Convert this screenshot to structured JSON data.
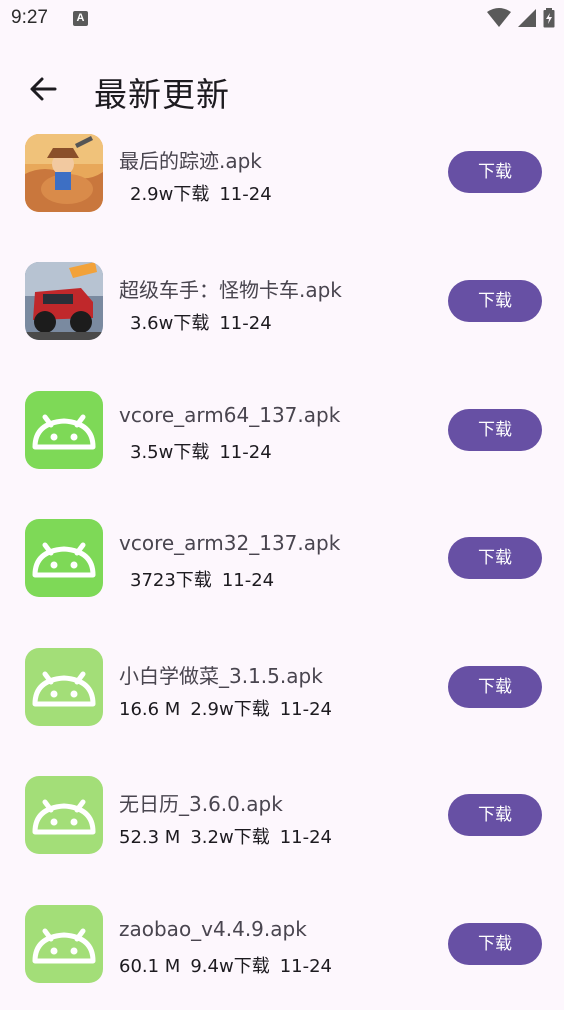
{
  "status_bar": {
    "time": "9:27",
    "notification_icon_letter": "A"
  },
  "app_bar": {
    "title": "最新更新"
  },
  "colors": {
    "accent": "#6750a4",
    "android_green_dark": "#7ed957",
    "android_green_light": "#a3de78"
  },
  "items": [
    {
      "name": "最后的踪迹.apk",
      "size": "",
      "downloads": "2.9w下载",
      "date": "11-24",
      "button": "下载",
      "icon": "cowboy-game-icon"
    },
    {
      "name": "超级车手：怪物卡车.apk",
      "size": "",
      "downloads": "3.6w下载",
      "date": "11-24",
      "button": "下载",
      "icon": "monster-truck-game-icon"
    },
    {
      "name": "vcore_arm64_137.apk",
      "size": "",
      "downloads": "3.5w下载",
      "date": "11-24",
      "button": "下载",
      "icon": "android-icon"
    },
    {
      "name": "vcore_arm32_137.apk",
      "size": "",
      "downloads": "3723下载",
      "date": "11-24",
      "button": "下载",
      "icon": "android-icon"
    },
    {
      "name": "小白学做菜_3.1.5.apk",
      "size": "16.6 M",
      "downloads": "2.9w下载",
      "date": "11-24",
      "button": "下载",
      "icon": "android-icon"
    },
    {
      "name": "无日历_3.6.0.apk",
      "size": "52.3 M",
      "downloads": "3.2w下载",
      "date": "11-24",
      "button": "下载",
      "icon": "android-icon"
    },
    {
      "name": "zaobao_v4.4.9.apk",
      "size": "60.1 M",
      "downloads": "9.4w下载",
      "date": "11-24",
      "button": "下载",
      "icon": "android-icon"
    }
  ]
}
